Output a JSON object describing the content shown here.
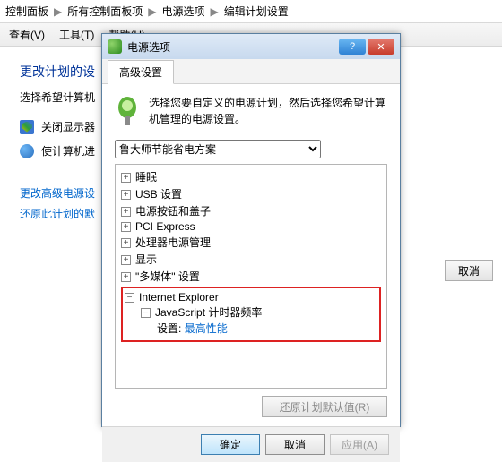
{
  "breadcrumb": {
    "p0": "控制面板",
    "p1": "所有控制面板项",
    "p2": "电源选项",
    "p3": "编辑计划设置"
  },
  "menubar": {
    "view": "查看(V)",
    "tools": "工具(T)",
    "help": "帮助(H)"
  },
  "page": {
    "heading": "更改计划的设",
    "subheading": "选择希望计算机",
    "opt_display": "关闭显示器",
    "opt_sleep": "使计算机进",
    "link_advanced": "更改高级电源设",
    "link_restore": "还原此计划的默",
    "cancel_btn": "取消"
  },
  "dialog": {
    "title": "电源选项",
    "tab": "高级设置",
    "intro": "选择您要自定义的电源计划，然后选择您希望计算机管理的电源设置。",
    "plan": "鲁大师节能省电方案",
    "tree": {
      "hdd": "睡眠",
      "usb": "USB 设置",
      "buttons_lid": "电源按钮和盖子",
      "pci": "PCI Express",
      "cpu": "处理器电源管理",
      "display": "显示",
      "media": "\"多媒体\" 设置",
      "ie": "Internet Explorer",
      "js_timer": "JavaScript 计时器频率",
      "setting_label": "设置:",
      "setting_value": "最高性能"
    },
    "restore_defaults": "还原计划默认值(R)",
    "ok": "确定",
    "cancel": "取消",
    "apply": "应用(A)"
  }
}
